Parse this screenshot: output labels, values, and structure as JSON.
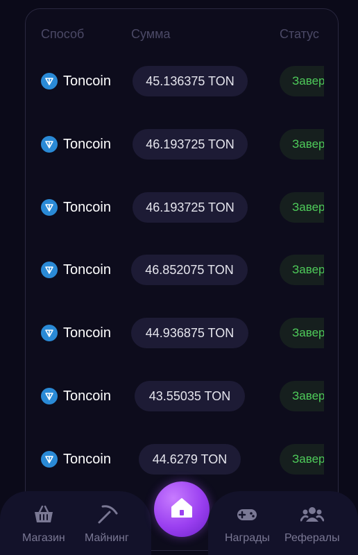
{
  "table": {
    "headers": {
      "method": "Способ",
      "amount": "Сумма",
      "status": "Статус"
    },
    "rows": [
      {
        "method": "Toncoin",
        "amount": "45.136375 TON",
        "status": "Завер"
      },
      {
        "method": "Toncoin",
        "amount": "46.193725 TON",
        "status": "Завер"
      },
      {
        "method": "Toncoin",
        "amount": "46.193725 TON",
        "status": "Завер"
      },
      {
        "method": "Toncoin",
        "amount": "46.852075 TON",
        "status": "Завер"
      },
      {
        "method": "Toncoin",
        "amount": "44.936875 TON",
        "status": "Завер"
      },
      {
        "method": "Toncoin",
        "amount": "43.55035 TON",
        "status": "Завер"
      },
      {
        "method": "Toncoin",
        "amount": "44.6279 TON",
        "status": "Завер"
      }
    ],
    "method_icon": "ton-icon",
    "status_color": "#4ecb5a"
  },
  "nav": {
    "shop": {
      "label": "Магазин",
      "icon": "basket-icon"
    },
    "mining": {
      "label": "Майнинг",
      "icon": "pickaxe-icon"
    },
    "home": {
      "icon": "home-icon"
    },
    "rewards": {
      "label": "Награды",
      "icon": "gamepad-icon"
    },
    "referrals": {
      "label": "Рефералы",
      "icon": "users-icon"
    }
  },
  "colors": {
    "background": "#0b0a19",
    "accent": "#9a3ff0",
    "amount_pill": "#1d1b35"
  }
}
